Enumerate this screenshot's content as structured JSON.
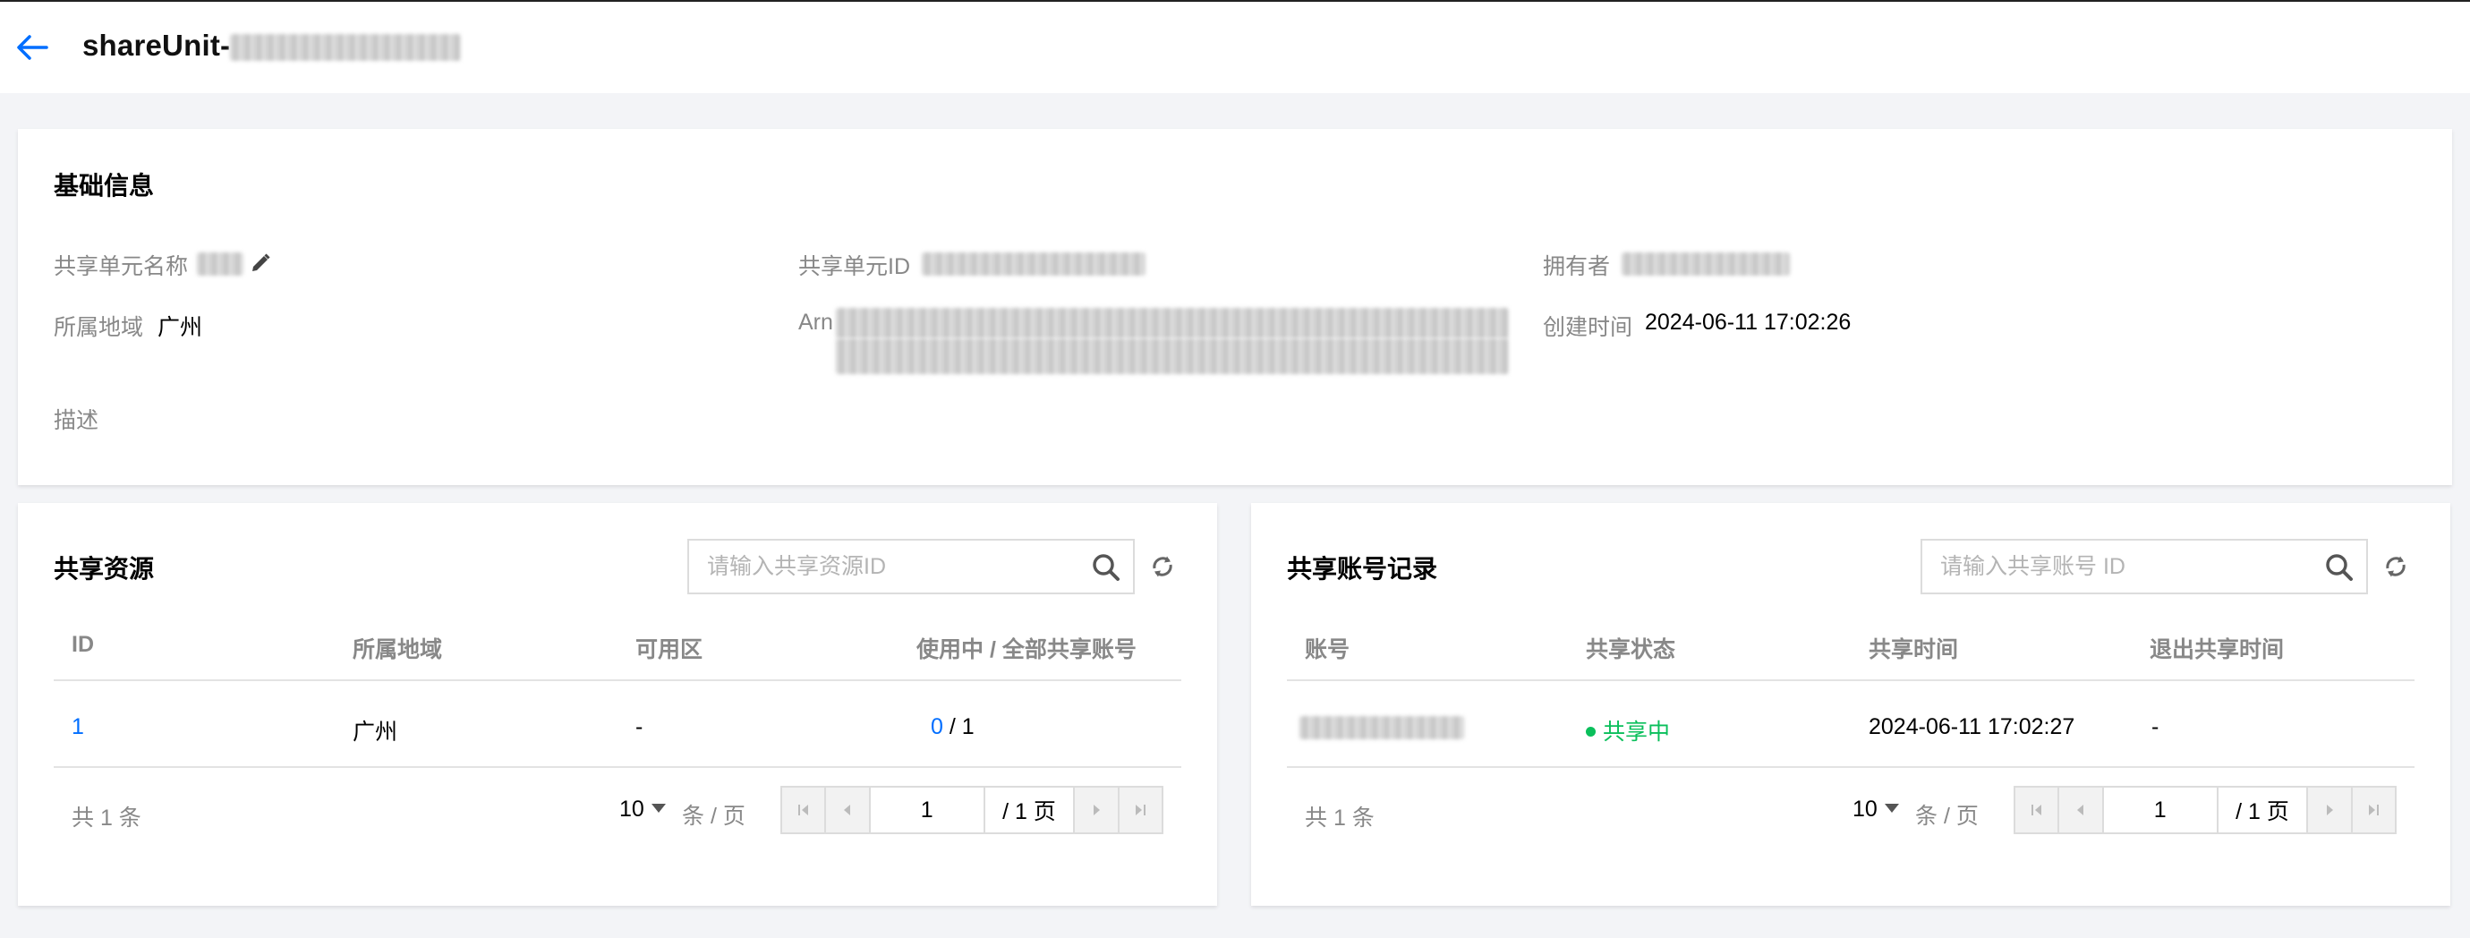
{
  "header": {
    "title_prefix": "shareUnit-"
  },
  "basic_info": {
    "title": "基础信息",
    "share_unit_name_label": "共享单元名称",
    "share_unit_id_label": "共享单元ID",
    "owner_label": "拥有者",
    "region_label": "所属地域",
    "region_value": "广州",
    "arn_label": "Arn",
    "created_time_label": "创建时间",
    "created_time_value": "2024-06-11 17:02:26",
    "description_label": "描述"
  },
  "shared_resources": {
    "title": "共享资源",
    "search_placeholder": "请输入共享资源ID",
    "columns": [
      "ID",
      "所属地域",
      "可用区",
      "使用中 / 全部共享账号"
    ],
    "rows": [
      {
        "id": "1",
        "region": "广州",
        "zone": "-",
        "in_use": "0",
        "total": " / 1"
      }
    ],
    "total_text": "共 1 条",
    "page_size": "10",
    "per_page_text": "条 / 页",
    "page_input": "1",
    "page_total": "/ 1 页"
  },
  "share_records": {
    "title": "共享账号记录",
    "search_placeholder": "请输入共享账号 ID",
    "columns": [
      "账号",
      "共享状态",
      "共享时间",
      "退出共享时间"
    ],
    "rows": [
      {
        "status": "共享中",
        "share_time": "2024-06-11 17:02:27",
        "exit_time": "-"
      }
    ],
    "total_text": "共 1 条",
    "page_size": "10",
    "per_page_text": "条 / 页",
    "page_input": "1",
    "page_total": "/ 1 页"
  },
  "colors": {
    "accent": "#006eff",
    "success": "#0abf5b",
    "background": "#f3f4f7"
  }
}
